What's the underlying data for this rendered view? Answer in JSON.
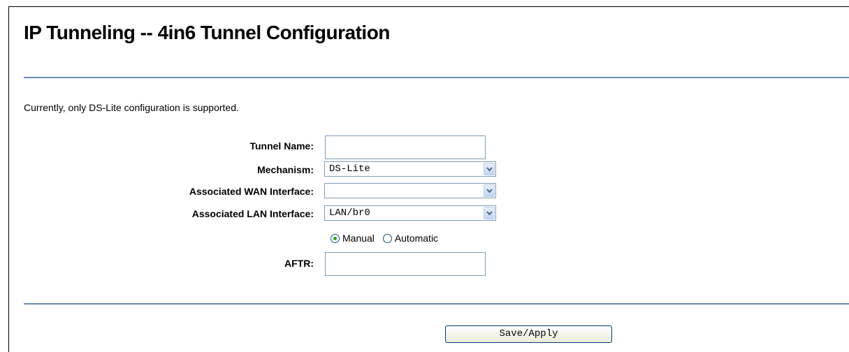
{
  "page": {
    "title": "IP Tunneling -- 4in6 Tunnel Configuration",
    "note": "Currently, only DS-Lite configuration is supported."
  },
  "form": {
    "tunnel_name": {
      "label": "Tunnel Name:",
      "value": ""
    },
    "mechanism": {
      "label": "Mechanism:",
      "value": "DS-Lite"
    },
    "wan_interface": {
      "label": "Associated WAN Interface:",
      "value": ""
    },
    "lan_interface": {
      "label": "Associated LAN Interface:",
      "value": "LAN/br0"
    },
    "aftr_mode": {
      "options": [
        {
          "label": "Manual",
          "checked": true
        },
        {
          "label": "Automatic",
          "checked": false
        }
      ]
    },
    "aftr": {
      "label": "AFTR:",
      "value": ""
    }
  },
  "actions": {
    "save_label": "Save/Apply"
  },
  "icons": {
    "select_arrow": "chevron-down-icon",
    "radio": "radio-button-icon"
  },
  "colors": {
    "rule": "#6b8ab5",
    "input_border": "#7f9db9",
    "radio_dot": "#21a121",
    "button_border": "#003c74"
  }
}
